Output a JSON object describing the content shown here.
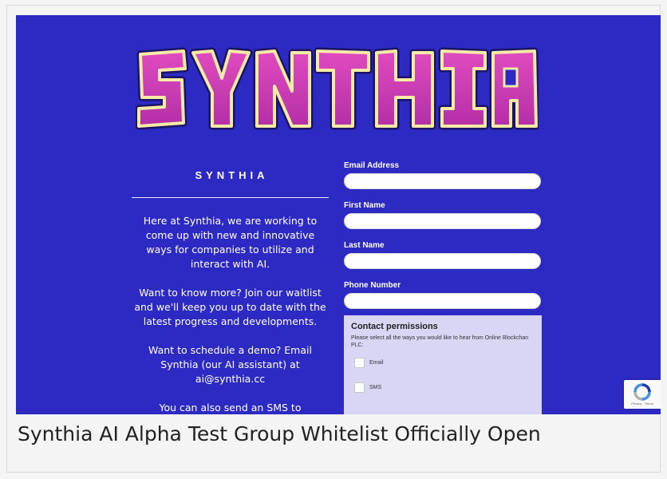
{
  "site": {
    "logo_text": "SYNTHIA",
    "brand": "SYNTHIA",
    "paragraphs": [
      "Here at Synthia, we are working to come up with new and innovative ways for companies to utilize and interact with AI.",
      "Want to know more? Join our waitlist and we'll keep you up to date with the latest progress and developments.",
      "Want to schedule a demo? Email Synthia (our AI assistant) at ai@synthia.cc",
      "You can also send an SMS to"
    ]
  },
  "form": {
    "email_label": "Email Address",
    "first_name_label": "First Name",
    "last_name_label": "Last Name",
    "phone_label": "Phone Number"
  },
  "permissions": {
    "title": "Contact permissions",
    "description": "Please select all the ways you would like to hear from Online Blockchan PLC:",
    "options": [
      "Email",
      "SMS"
    ]
  },
  "recaptcha": {
    "links": "Privacy - Terms"
  },
  "caption": "Synthia AI Alpha Test Group Whitelist Officially Open",
  "colors": {
    "background": "#2d2ac4",
    "logo_fill": "#d03ab0",
    "logo_outline": "#f7e9a6",
    "panel": "#d8d6f4"
  }
}
